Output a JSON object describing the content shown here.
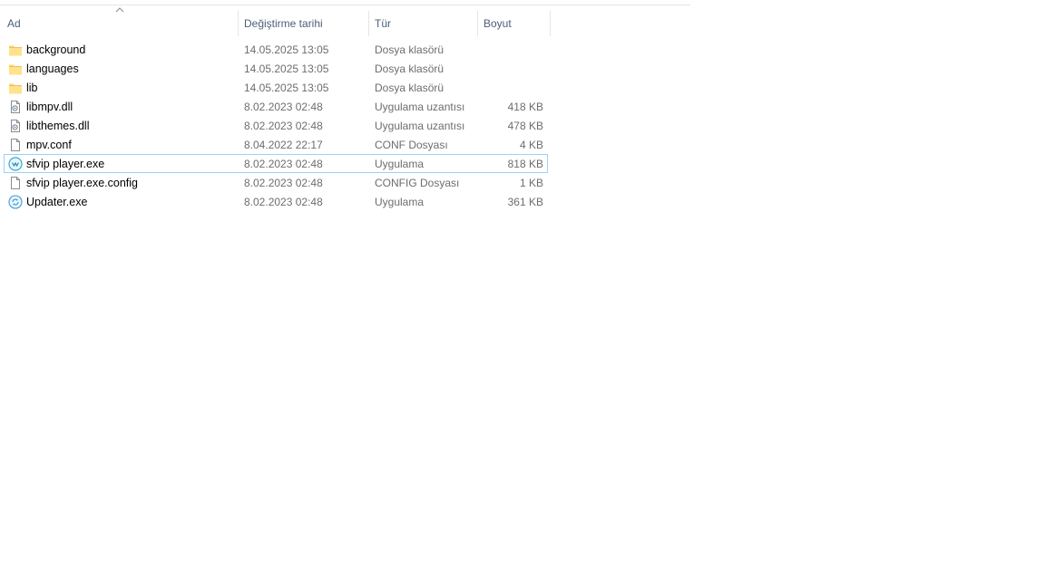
{
  "columns": {
    "name": "Ad",
    "date": "Değiştirme tarihi",
    "type": "Tür",
    "size": "Boyut"
  },
  "colors": {
    "folder": "#f8d775",
    "selection_border": "#99d1ff",
    "header_text": "#4c607a",
    "detail_text": "#6d6d6d"
  },
  "files": [
    {
      "name": "background",
      "date": "14.05.2025 13:05",
      "type": "Dosya klasörü",
      "size": "",
      "icon": "folder-icon"
    },
    {
      "name": "languages",
      "date": "14.05.2025 13:05",
      "type": "Dosya klasörü",
      "size": "",
      "icon": "folder-icon"
    },
    {
      "name": "lib",
      "date": "14.05.2025 13:05",
      "type": "Dosya klasörü",
      "size": "",
      "icon": "folder-icon"
    },
    {
      "name": "libmpv.dll",
      "date": "8.02.2023 02:48",
      "type": "Uygulama uzantısı",
      "size": "418 KB",
      "icon": "dll-file-icon"
    },
    {
      "name": "libthemes.dll",
      "date": "8.02.2023 02:48",
      "type": "Uygulama uzantısı",
      "size": "478 KB",
      "icon": "dll-file-icon"
    },
    {
      "name": "mpv.conf",
      "date": "8.04.2022 22:17",
      "type": "CONF Dosyası",
      "size": "4 KB",
      "icon": "file-icon"
    },
    {
      "name": "sfvip player.exe",
      "date": "8.02.2023 02:48",
      "type": "Uygulama",
      "size": "818 KB",
      "icon": "sfvip-player-icon",
      "selected": true
    },
    {
      "name": "sfvip player.exe.config",
      "date": "8.02.2023 02:48",
      "type": "CONFIG Dosyası",
      "size": "1 KB",
      "icon": "file-icon"
    },
    {
      "name": "Updater.exe",
      "date": "8.02.2023 02:48",
      "type": "Uygulama",
      "size": "361 KB",
      "icon": "updater-icon"
    }
  ]
}
